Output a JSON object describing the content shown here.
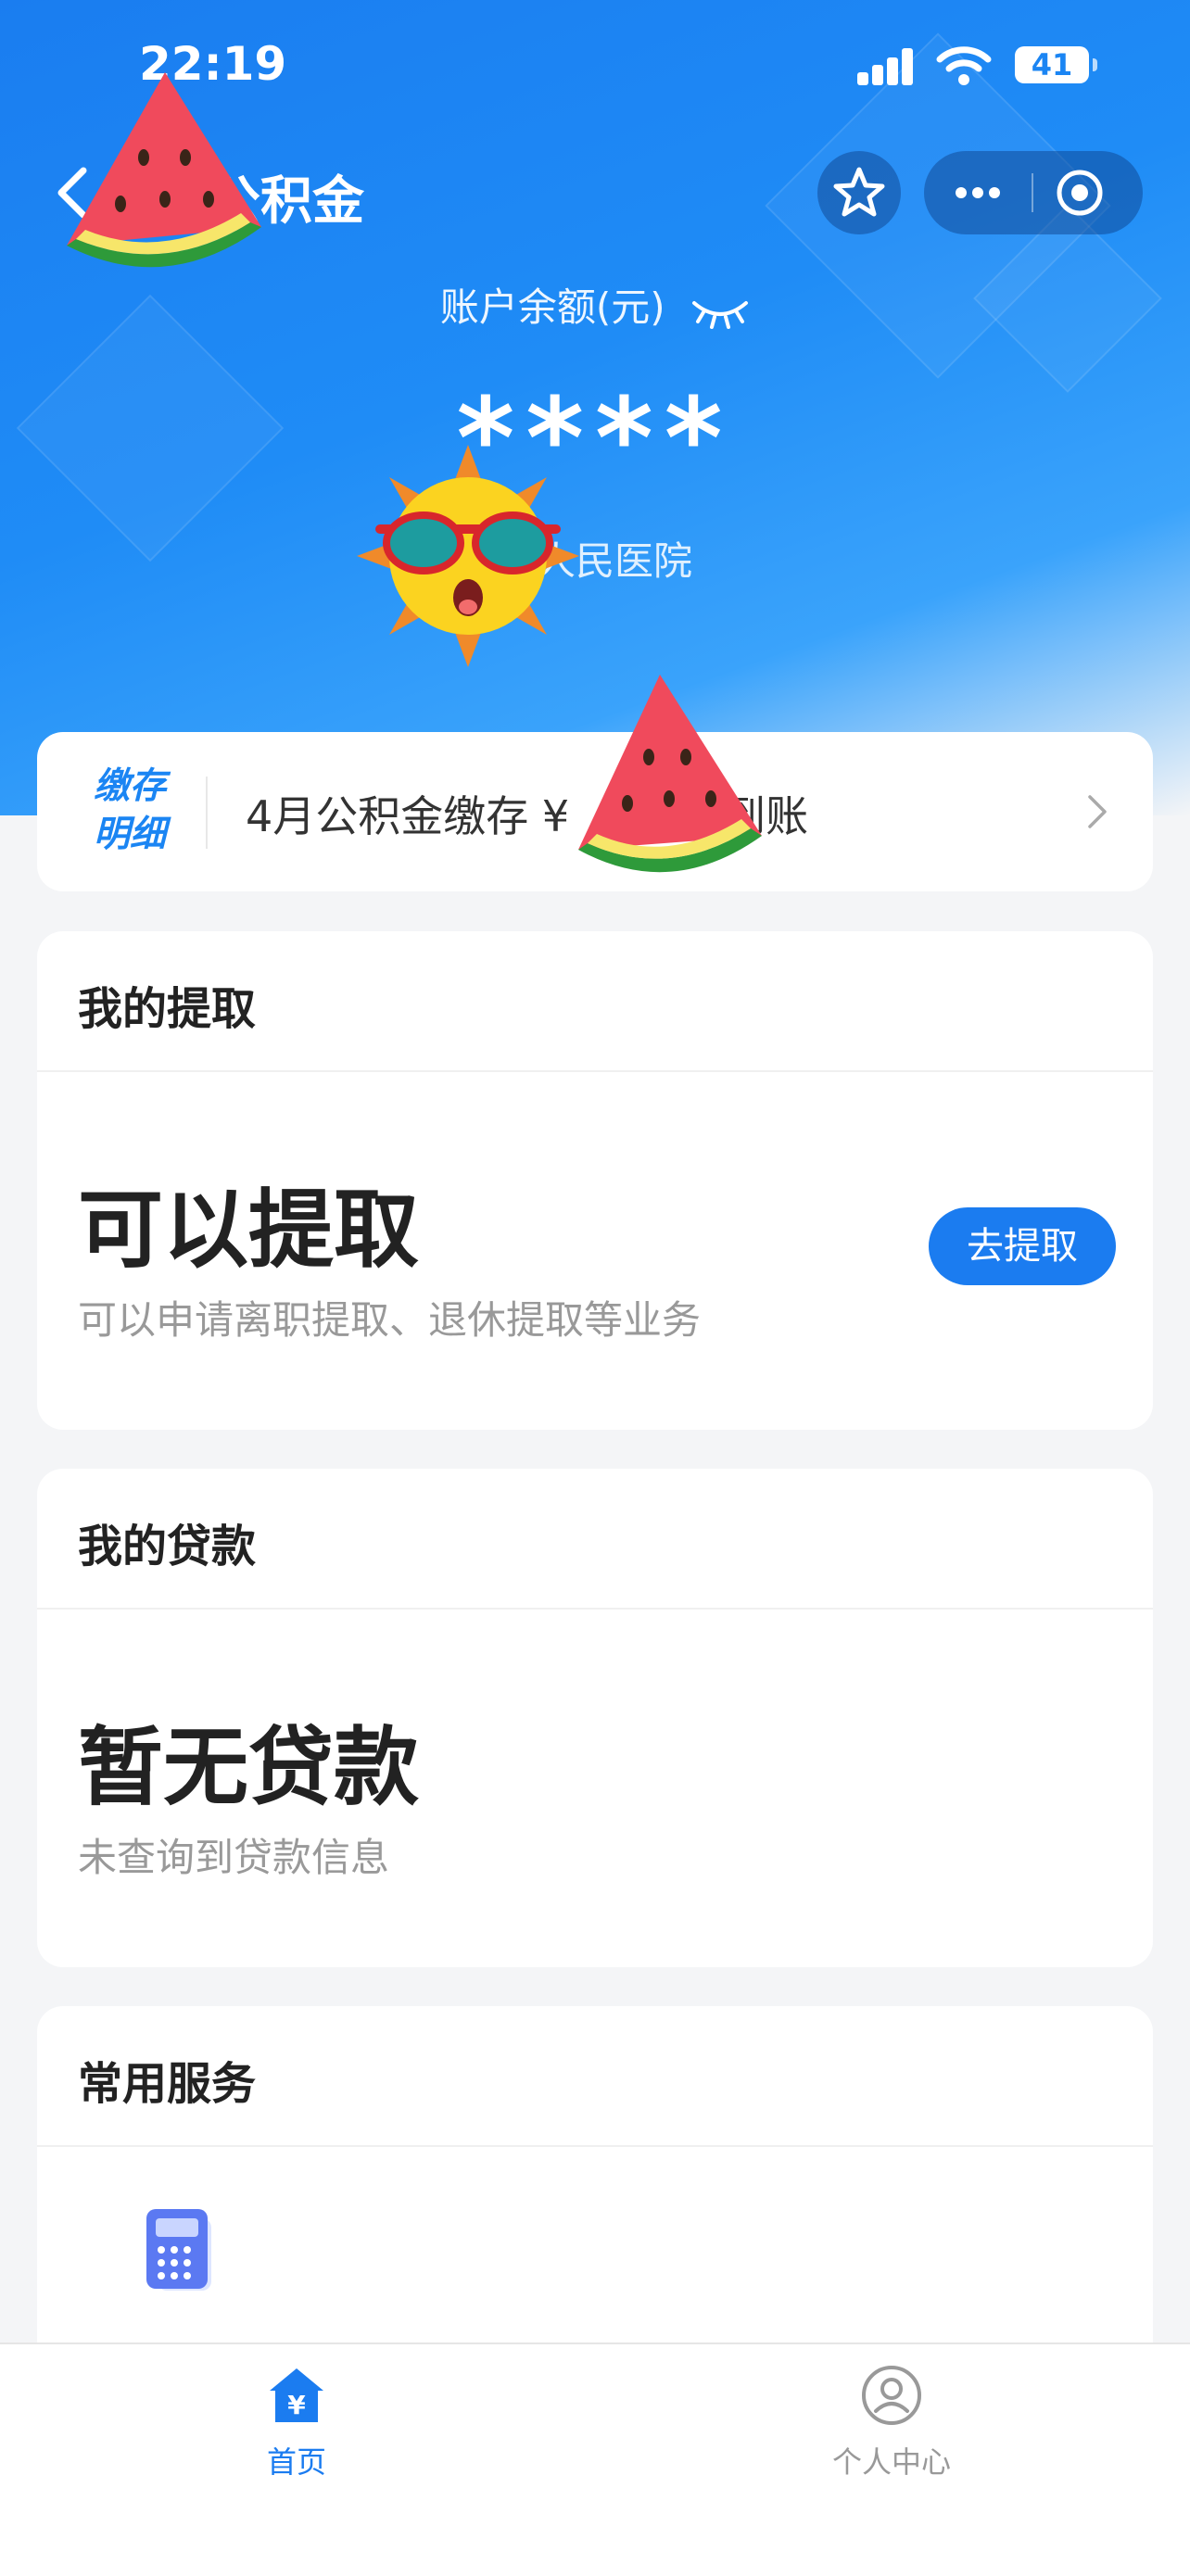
{
  "status_bar": {
    "time": "22:19",
    "battery": "41"
  },
  "nav": {
    "title": "公积金"
  },
  "account": {
    "balance_label": "账户余额(元)",
    "balance_value": "****",
    "employer": "市人民医院"
  },
  "notice": {
    "badge_line1": "缴存",
    "badge_line2": "明细",
    "text_before": "4月公积金缴存 ¥",
    "text_after": "已到账"
  },
  "withdrawal": {
    "header": "我的提取",
    "status": "可以提取",
    "description": "可以申请离职提取、退休提取等业务",
    "button_label": "去提取"
  },
  "loan": {
    "header": "我的贷款",
    "status": "暂无贷款",
    "description": "未查询到贷款信息"
  },
  "services": {
    "header": "常用服务",
    "items": [
      {
        "icon": "calculator-icon"
      }
    ]
  },
  "tabbar": {
    "items": [
      {
        "label": "首页",
        "icon": "home-yuan-icon",
        "active": true
      },
      {
        "label": "个人中心",
        "icon": "user-circle-icon",
        "active": false
      }
    ]
  },
  "colors": {
    "primary": "#1b7cf0",
    "background": "#f4f5f7",
    "muted": "#999999"
  },
  "stickers": [
    "watermelon-slice",
    "sun-with-sunglasses",
    "watermelon-slice"
  ]
}
